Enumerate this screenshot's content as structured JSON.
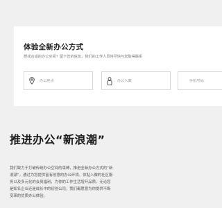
{
  "form": {
    "title": "体验全新办公方式",
    "subtitle": "想找合适的办公空间？留下您的信息，我们的工作人员将尽快与您取得联系",
    "office_placeholder": "办公地点",
    "people_placeholder": "办公人数",
    "phone_placeholder": "手机号码"
  },
  "section": {
    "headline": "推进办公“新浪潮”",
    "body": "我们致力于打破传统办公空间的束缚，推进全新办公方式的“新浪潮”，通过为您提供富有创意的办公环境、体贴入微的社区服务以及多元化的会员福利，为你的工作生活增开品质。无论您是知名企业还是成长中的初创公司，我们都愿意为你提供不断变革的优质办公体验。"
  },
  "icons": {
    "office": "location-pin-icon",
    "people": "person-icon"
  }
}
